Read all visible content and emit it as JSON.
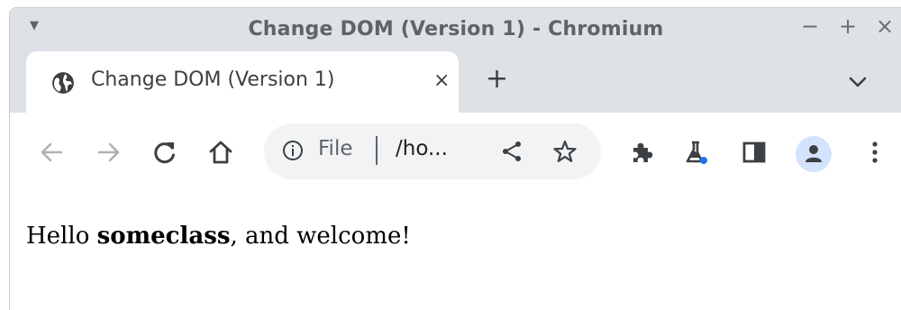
{
  "window": {
    "title": "Change DOM (Version 1) - Chromium",
    "menu_icon": "caret-down-icon",
    "controls": {
      "minimize": "−",
      "maximize": "+",
      "close": "×"
    }
  },
  "tabs": [
    {
      "title": "Change DOM (Version 1)",
      "icon": "globe-icon",
      "close": "×",
      "active": true
    }
  ],
  "tabstrip": {
    "new_tab": "+",
    "search_tabs_icon": "chevron-down-icon"
  },
  "toolbar": {
    "back_icon": "arrow-left-icon",
    "forward_icon": "arrow-right-icon",
    "reload_icon": "reload-icon",
    "home_icon": "home-icon",
    "extensions_icon": "puzzle-icon",
    "labs_icon": "flask-icon",
    "side_panel_icon": "side-panel-icon",
    "profile_icon": "person-icon",
    "menu_icon": "kebab-icon"
  },
  "omnibox": {
    "scheme": "File",
    "url": "/ho...",
    "info_icon": "info-icon",
    "share_icon": "share-icon",
    "bookmark_icon": "star-icon"
  },
  "page": {
    "greeting_before": "Hello ",
    "name": "someclass",
    "greeting_after": ", and welcome!"
  },
  "colors": {
    "chrome_bg": "#dee1e6",
    "omnibox_bg": "#f1f3f4",
    "icon_gray": "#5f6368",
    "labs_dot": "#1a73e8",
    "avatar_bg": "#d3e3fd"
  }
}
